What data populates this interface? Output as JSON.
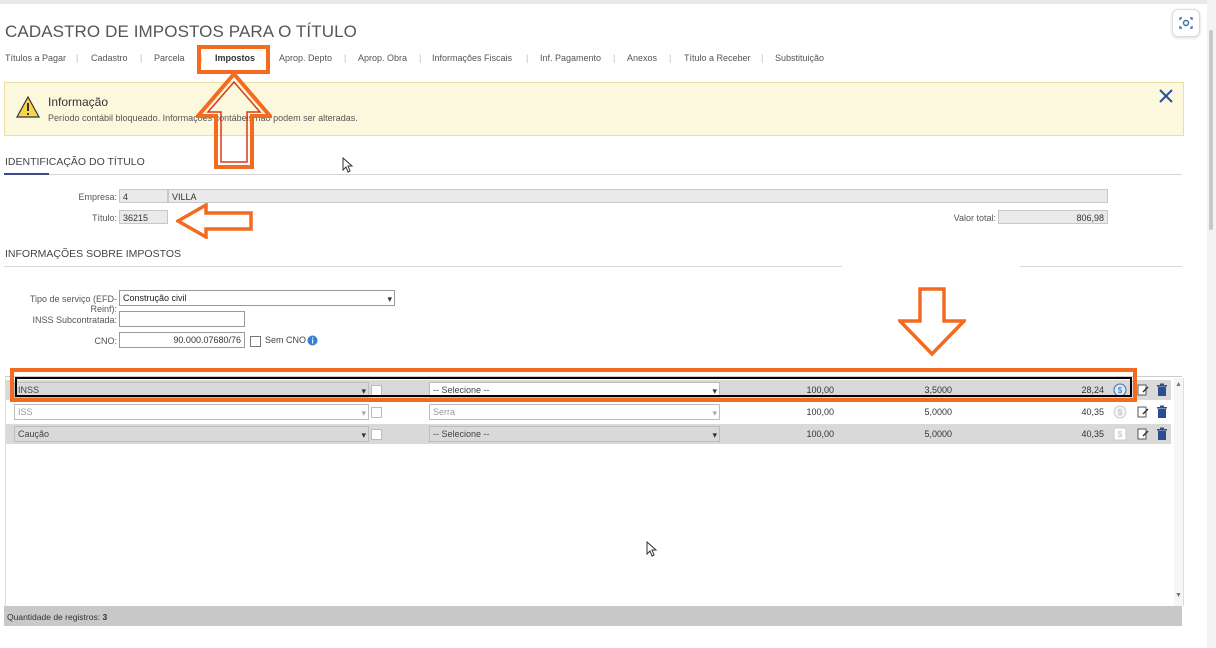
{
  "window": {
    "title": "CADASTRO DE IMPOSTOS PARA O TÍTULO"
  },
  "tabs": [
    {
      "label": "Títulos a Pagar",
      "active": false
    },
    {
      "label": "Cadastro",
      "active": false
    },
    {
      "label": "Parcela",
      "active": false
    },
    {
      "label": "Impostos",
      "active": true
    },
    {
      "label": "Aprop. Depto",
      "active": false
    },
    {
      "label": "Aprop. Obra",
      "active": false
    },
    {
      "label": "Informações Fiscais",
      "active": false
    },
    {
      "label": "Inf. Pagamento",
      "active": false
    },
    {
      "label": "Anexos",
      "active": false
    },
    {
      "label": "Título a Receber",
      "active": false
    },
    {
      "label": "Substituição",
      "active": false
    }
  ],
  "info": {
    "title": "Informação",
    "message": "Período contábil bloqueado. Informações contábeis não podem ser alteradas."
  },
  "identificacao": {
    "section_title": "IDENTIFICAÇÃO DO TÍTULO",
    "empresa_label": "Empresa:",
    "empresa_codigo": "4",
    "empresa_nome": "VILLA",
    "titulo_label": "Título:",
    "titulo_valor": "36215",
    "valor_total_label": "Valor total:",
    "valor_total": "806,98"
  },
  "impostos": {
    "section_title": "INFORMAÇÕES SOBRE IMPOSTOS",
    "tipo_servico_label": "Tipo de serviço (EFD-Reinf):",
    "tipo_servico_value": "Construção civil",
    "inss_sub_label": "INSS Subcontratada:",
    "inss_sub_value": "",
    "cno_label": "CNO:",
    "cno_value": "90.000.07680/76",
    "sem_cno_label": "Sem CNO"
  },
  "grid": {
    "rows": [
      {
        "imposto": "INSS",
        "municipio": "-- Selecione --",
        "base": "100,00",
        "aliquota": "3,5000",
        "valor": "28,24"
      },
      {
        "imposto": "ISS",
        "municipio": "Serra",
        "base": "100,00",
        "aliquota": "5,0000",
        "valor": "40,35"
      },
      {
        "imposto": "Caução",
        "municipio": "-- Selecione --",
        "base": "100,00",
        "aliquota": "5,0000",
        "valor": "40,35"
      }
    ],
    "footer_label": "Quantidade de registros:",
    "footer_count": "3"
  },
  "colors": {
    "highlight": "#f36b21",
    "accent": "#3a4a8a",
    "info_bg": "#fcf8dd"
  }
}
